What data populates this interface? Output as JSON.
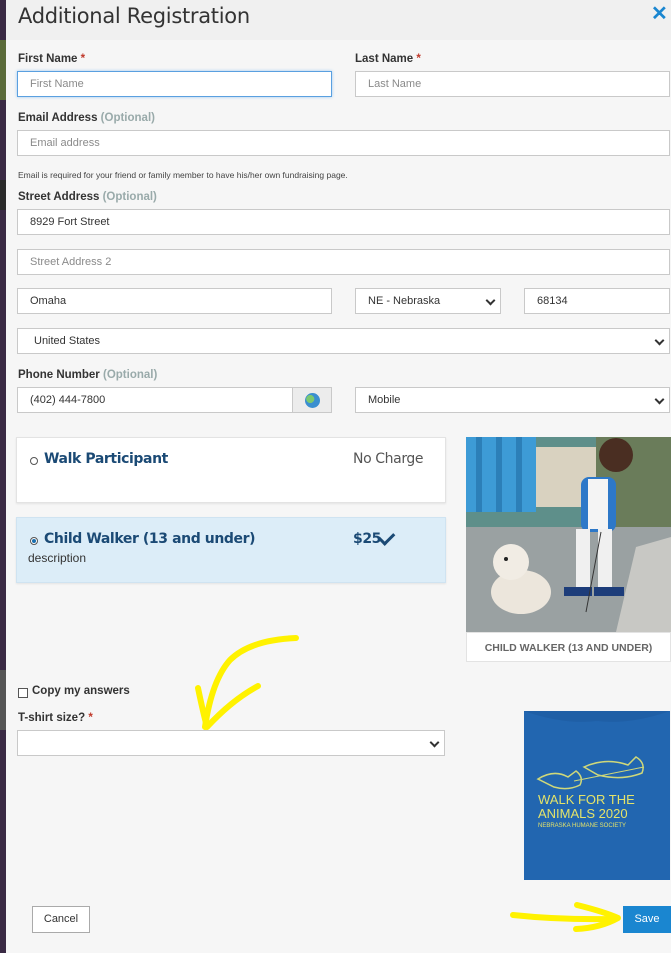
{
  "modal": {
    "title": "Additional Registration"
  },
  "form": {
    "first_name": {
      "label": "First Name",
      "required": "*",
      "placeholder": "First Name"
    },
    "last_name": {
      "label": "Last Name",
      "required": "*",
      "placeholder": "Last Name"
    },
    "email": {
      "label": "Email Address",
      "optional": "(Optional)",
      "placeholder": "Email address",
      "note": "Email is required for your friend or family member to have his/her own fundraising page."
    },
    "street": {
      "label": "Street Address",
      "optional": "(Optional)",
      "value": "8929 Fort Street",
      "placeholder2": "Street Address 2"
    },
    "city": {
      "value": "Omaha"
    },
    "state": {
      "value": "NE - Nebraska"
    },
    "zip": {
      "value": "68134"
    },
    "country": {
      "value": "United States"
    },
    "phone": {
      "label": "Phone Number",
      "optional": "(Optional)",
      "value": "(402) 444-7800",
      "type": "Mobile",
      "icon": "globe-icon"
    }
  },
  "options": [
    {
      "name": "Walk Participant",
      "price": "No Charge",
      "selected": false
    },
    {
      "name": "Child Walker (13 and under)",
      "price": "$25",
      "selected": true,
      "description": "description"
    }
  ],
  "photo": {
    "caption": "CHILD WALKER (13 AND UNDER)"
  },
  "copy_answers": {
    "label": "Copy my answers"
  },
  "tshirt": {
    "label": "T-shirt size?",
    "required": "*",
    "value": "",
    "image_text": [
      "WALK FOR THE",
      "ANIMALS 2020",
      "NEBRASKA HUMANE SOCIETY"
    ]
  },
  "buttons": {
    "cancel": "Cancel",
    "save": "Save"
  },
  "colors": {
    "accent": "#1a86d0",
    "title_blue": "#1b4a75",
    "selected_bg": "#dcedf8",
    "annotation": "#fff200"
  }
}
